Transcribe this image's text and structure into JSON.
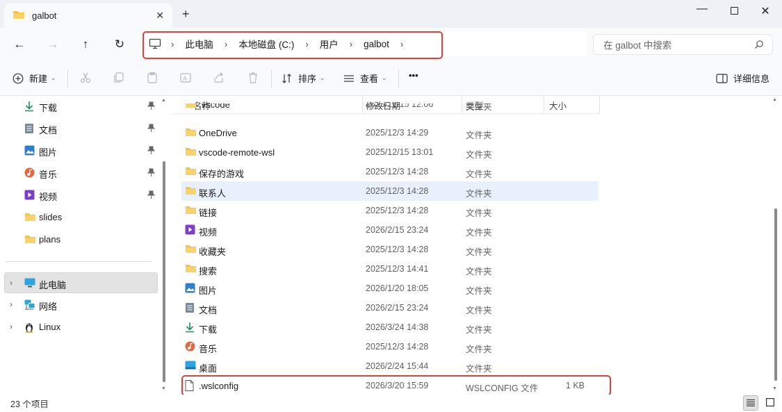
{
  "window": {
    "tab_title": "galbot",
    "close_tab_glyph": "✕",
    "new_tab_glyph": "+",
    "minimize_glyph": "—",
    "close_glyph": "✕"
  },
  "nav": {
    "back_glyph": "←",
    "forward_glyph": "→",
    "up_glyph": "↑",
    "refresh_glyph": "↻"
  },
  "breadcrumb": {
    "separator": "›",
    "items": [
      "此电脑",
      "本地磁盘 (C:)",
      "用户",
      "galbot"
    ]
  },
  "search": {
    "placeholder": "在 galbot 中搜索"
  },
  "toolbar": {
    "new_label": "新建",
    "sort_label": "排序",
    "view_label": "查看",
    "more_label": "•••",
    "details_label": "详细信息"
  },
  "sidebar": {
    "quick_access": [
      {
        "label": "下载",
        "icon": "download-icon",
        "pinned": true
      },
      {
        "label": "文档",
        "icon": "document-icon",
        "pinned": true
      },
      {
        "label": "图片",
        "icon": "picture-icon",
        "pinned": true
      },
      {
        "label": "音乐",
        "icon": "music-icon",
        "pinned": true
      },
      {
        "label": "视频",
        "icon": "video-icon",
        "pinned": true
      },
      {
        "label": "slides",
        "icon": "folder-icon",
        "pinned": false
      },
      {
        "label": "plans",
        "icon": "folder-icon",
        "pinned": false
      }
    ],
    "locations": [
      {
        "label": "此电脑",
        "icon": "computer-icon",
        "selected": true
      },
      {
        "label": "网络",
        "icon": "network-icon",
        "selected": false
      },
      {
        "label": "Linux",
        "icon": "linux-icon",
        "selected": false
      }
    ],
    "pin_glyph": "📌",
    "expand_glyph": "›"
  },
  "columns": {
    "name": "名称",
    "date": "修改日期",
    "type": "类型",
    "size": "大小"
  },
  "files": [
    {
      "name": ".vscode",
      "date": "2025/12/15 12:06",
      "type": "文件夹",
      "size": "",
      "icon": "folder-icon"
    },
    {
      "name": "OneDrive",
      "date": "2025/12/3 14:29",
      "type": "文件夹",
      "size": "",
      "icon": "folder-icon"
    },
    {
      "name": "vscode-remote-wsl",
      "date": "2025/12/15 13:01",
      "type": "文件夹",
      "size": "",
      "icon": "folder-icon"
    },
    {
      "name": "保存的游戏",
      "date": "2025/12/3 14:28",
      "type": "文件夹",
      "size": "",
      "icon": "folder-icon"
    },
    {
      "name": "联系人",
      "date": "2025/12/3 14:28",
      "type": "文件夹",
      "size": "",
      "icon": "folder-icon"
    },
    {
      "name": "链接",
      "date": "2025/12/3 14:28",
      "type": "文件夹",
      "size": "",
      "icon": "folder-icon"
    },
    {
      "name": "视频",
      "date": "2026/2/15 23:24",
      "type": "文件夹",
      "size": "",
      "icon": "video-icon"
    },
    {
      "name": "收藏夹",
      "date": "2025/12/3 14:28",
      "type": "文件夹",
      "size": "",
      "icon": "folder-icon"
    },
    {
      "name": "搜索",
      "date": "2025/12/3 14:41",
      "type": "文件夹",
      "size": "",
      "icon": "folder-icon"
    },
    {
      "name": "图片",
      "date": "2026/1/20 18:05",
      "type": "文件夹",
      "size": "",
      "icon": "picture-icon"
    },
    {
      "name": "文档",
      "date": "2026/2/15 23:24",
      "type": "文件夹",
      "size": "",
      "icon": "document-icon"
    },
    {
      "name": "下载",
      "date": "2026/3/24 14:38",
      "type": "文件夹",
      "size": "",
      "icon": "download-icon"
    },
    {
      "name": "音乐",
      "date": "2025/12/3 14:28",
      "type": "文件夹",
      "size": "",
      "icon": "music-icon"
    },
    {
      "name": "桌面",
      "date": "2026/2/24 15:44",
      "type": "文件夹",
      "size": "",
      "icon": "desktop-icon"
    },
    {
      "name": ".wslconfig",
      "date": "2026/3/20 15:59",
      "type": "WSLCONFIG 文件",
      "size": "1 KB",
      "icon": "file-icon"
    }
  ],
  "status": {
    "item_count": "23 个项目"
  },
  "colors": {
    "folder": "#f5c341",
    "highlight_border": "#d3443f",
    "hover_row": "#e8f1fb",
    "accent": "#0067c0"
  }
}
